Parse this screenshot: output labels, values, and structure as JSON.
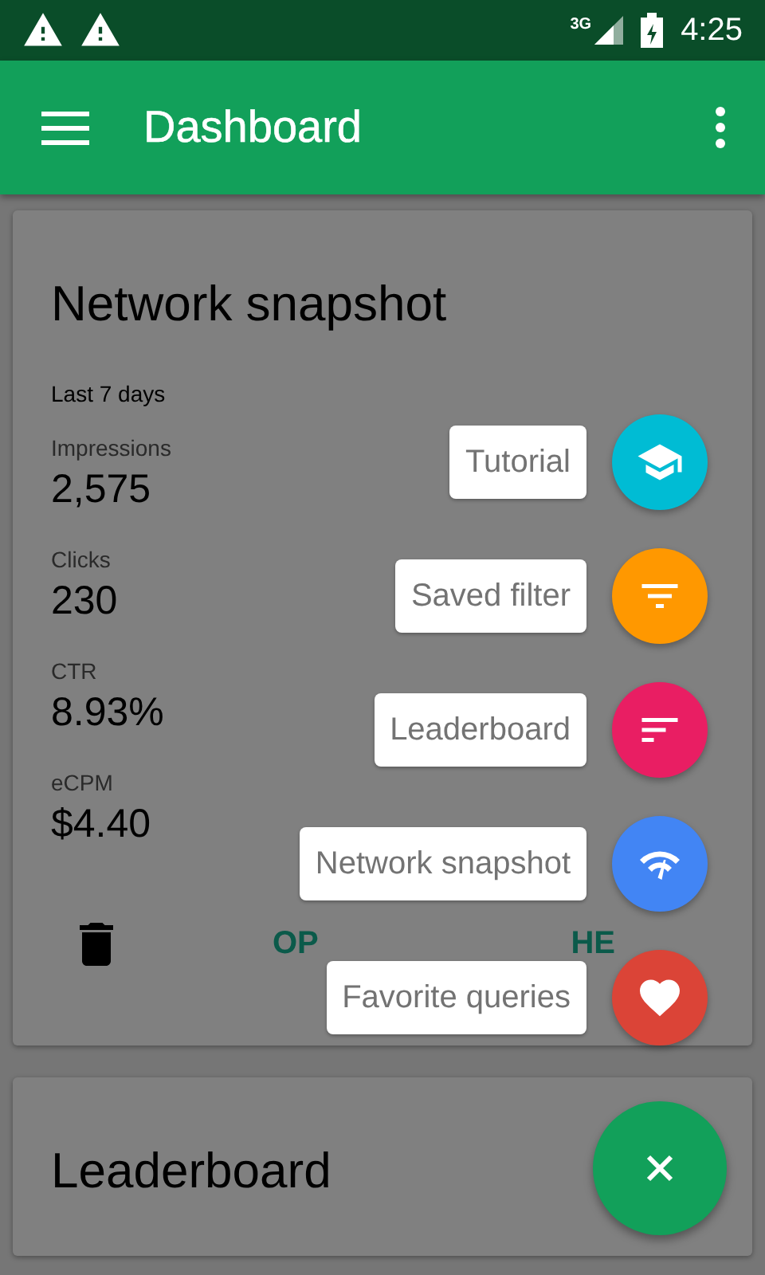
{
  "status_bar": {
    "network": "3G",
    "time": "4:25"
  },
  "app_bar": {
    "title": "Dashboard"
  },
  "cards": [
    {
      "title": "Network snapshot",
      "period": "Last 7 days",
      "metrics": [
        {
          "label": "Impressions",
          "value": "2,575"
        },
        {
          "label": "Clicks",
          "value": "230"
        },
        {
          "label": "CTR",
          "value": "8.93%"
        },
        {
          "label": "eCPM",
          "value": "$4.40"
        }
      ],
      "actions": [
        "OP",
        "HE"
      ]
    },
    {
      "title": "Leaderboard"
    }
  ],
  "fab_menu": {
    "expanded": true,
    "items": [
      {
        "label": "Tutorial",
        "color": "#00bcd4",
        "kind": "school"
      },
      {
        "label": "Saved filter",
        "color": "#ff9800",
        "kind": "filter"
      },
      {
        "label": "Leaderboard",
        "color": "#e91e63",
        "kind": "sort"
      },
      {
        "label": "Network snapshot",
        "color": "#4285f4",
        "kind": "network"
      },
      {
        "label": "Favorite queries",
        "color": "#db4437",
        "kind": "heart"
      }
    ]
  }
}
